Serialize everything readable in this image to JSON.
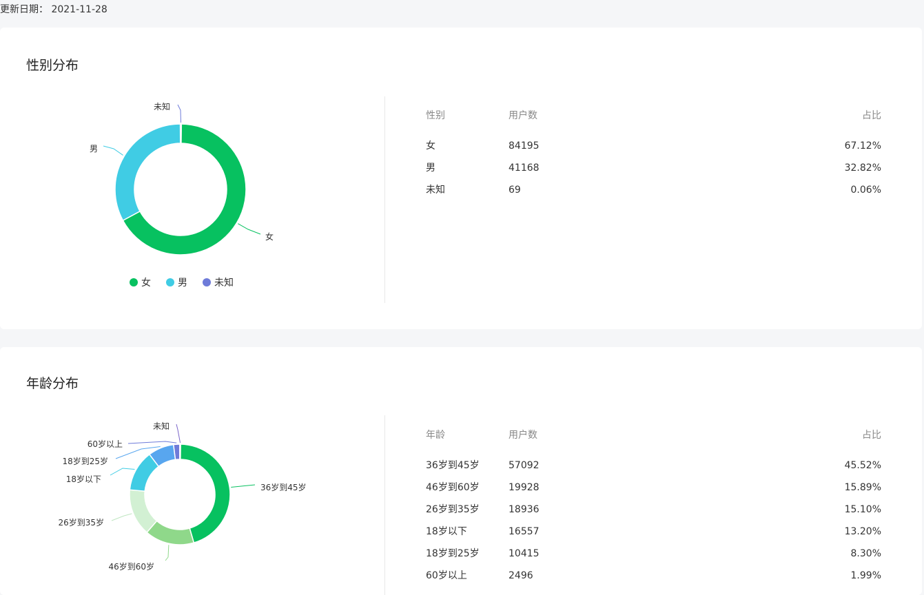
{
  "update": {
    "label": "更新日期：",
    "date": "2021-11-28"
  },
  "gender_section": {
    "title": "性别分布",
    "legend": [
      {
        "label": "女",
        "color": "#07c160"
      },
      {
        "label": "男",
        "color": "#40cce4"
      },
      {
        "label": "未知",
        "color": "#6e7bd9"
      }
    ],
    "table": {
      "headers": [
        "性别",
        "用户数",
        "占比"
      ],
      "rows": [
        {
          "name": "女",
          "count": "84195",
          "pct": "67.12%"
        },
        {
          "name": "男",
          "count": "41168",
          "pct": "32.82%"
        },
        {
          "name": "未知",
          "count": "69",
          "pct": "0.06%"
        }
      ]
    }
  },
  "age_section": {
    "title": "年龄分布",
    "table": {
      "headers": [
        "年龄",
        "用户数",
        "占比"
      ],
      "rows": [
        {
          "name": "36岁到45岁",
          "count": "57092",
          "pct": "45.52%"
        },
        {
          "name": "46岁到60岁",
          "count": "19928",
          "pct": "15.89%"
        },
        {
          "name": "26岁到35岁",
          "count": "18936",
          "pct": "15.10%"
        },
        {
          "name": "18岁以下",
          "count": "16557",
          "pct": "13.20%"
        },
        {
          "name": "18岁到25岁",
          "count": "10415",
          "pct": "8.30%"
        },
        {
          "name": "60岁以上",
          "count": "2496",
          "pct": "1.99%"
        }
      ]
    }
  },
  "chart_data": [
    {
      "type": "pie",
      "categories": [
        "女",
        "男",
        "未知"
      ],
      "values": [
        84195,
        41168,
        69
      ],
      "colors": [
        "#07c160",
        "#40cce4",
        "#6e7bd9"
      ],
      "legend": "bottom"
    },
    {
      "type": "pie",
      "categories": [
        "36岁到45岁",
        "46岁到60岁",
        "26岁到35岁",
        "18岁以下",
        "18岁到25岁",
        "60岁以上",
        "未知"
      ],
      "values": [
        57092,
        19928,
        18936,
        16557,
        10415,
        2496,
        30
      ],
      "colors": [
        "#07c160",
        "#8fd88a",
        "#d2f0d3",
        "#40cce4",
        "#58a6ef",
        "#6e7bd9",
        "#7a64c9"
      ]
    }
  ]
}
